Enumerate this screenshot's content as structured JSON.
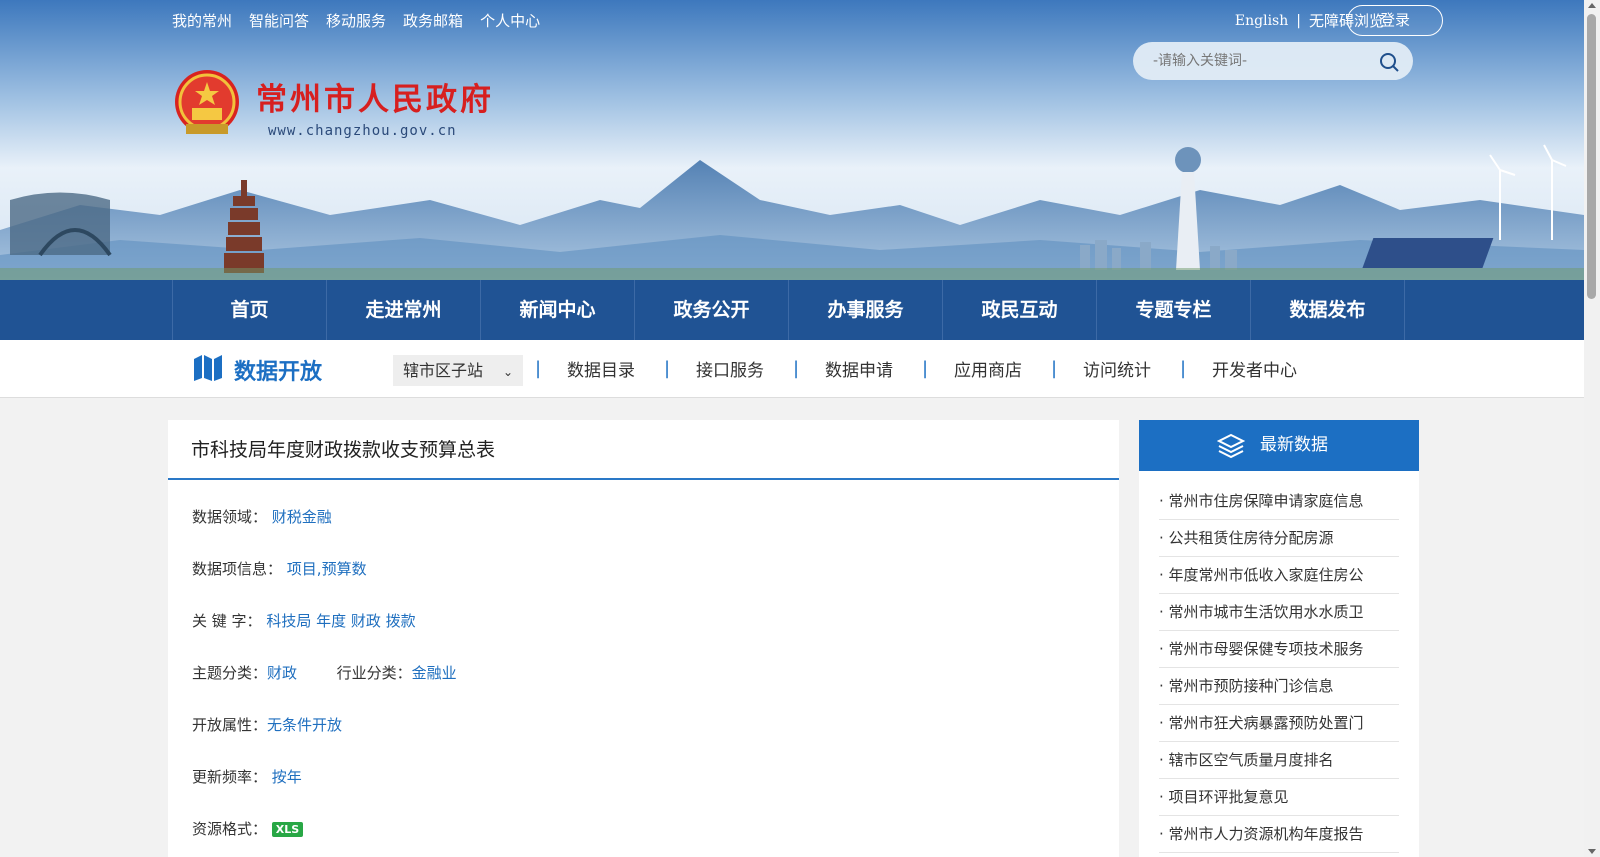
{
  "header": {
    "top_links": [
      "我的常州",
      "智能问答",
      "移动服务",
      "政务邮箱",
      "个人中心"
    ],
    "english": "English",
    "separator": "|",
    "accessibility": "无障碍浏览",
    "login": "登录",
    "search_placeholder": "-请输入关键词-",
    "site_name": "常州市人民政府",
    "site_url": "www.changzhou.gov.cn"
  },
  "main_nav": [
    "首页",
    "走进常州",
    "新闻中心",
    "政务公开",
    "办事服务",
    "政民互动",
    "专题专栏",
    "数据发布"
  ],
  "sub_nav": {
    "title": "数据开放",
    "region_select": "辖市区子站",
    "links": [
      "数据目录",
      "接口服务",
      "数据申请",
      "应用商店",
      "访问统计",
      "开发者中心"
    ]
  },
  "dataset": {
    "title": "市科技局年度财政拨款收支预算总表",
    "domain_label": "数据领域：",
    "domain_value": "财税金融",
    "items_label": "数据项信息：",
    "items_value": "项目,预算数",
    "keywords_label": "关 键 字：",
    "keywords_value": "科技局 年度 财政 拨款",
    "topic_label": "主题分类：",
    "topic_value": "财政",
    "industry_label": "行业分类：",
    "industry_value": "金融业",
    "open_label": "开放属性：",
    "open_value": "无条件开放",
    "freq_label": "更新频率：",
    "freq_value": "按年",
    "format_label": "资源格式：",
    "format_value": "XLS"
  },
  "latest": {
    "title": "最新数据",
    "items": [
      "· 常州市住房保障申请家庭信息",
      "· 公共租赁住房待分配房源",
      "· 年度常州市低收入家庭住房公",
      "· 常州市城市生活饮用水水质卫",
      "· 常州市母婴保健专项技术服务",
      "· 常州市预防接种门诊信息",
      "· 常州市狂犬病暴露预防处置门",
      "· 辖市区空气质量月度排名",
      "· 项目环评批复意见",
      "· 常州市人力资源机构年度报告"
    ]
  },
  "colors": {
    "nav_blue": "#205394",
    "accent_blue": "#1c6fc3",
    "title_red": "#d71f1f",
    "link_blue": "#1f6fbf",
    "xls_green": "#28a745"
  }
}
